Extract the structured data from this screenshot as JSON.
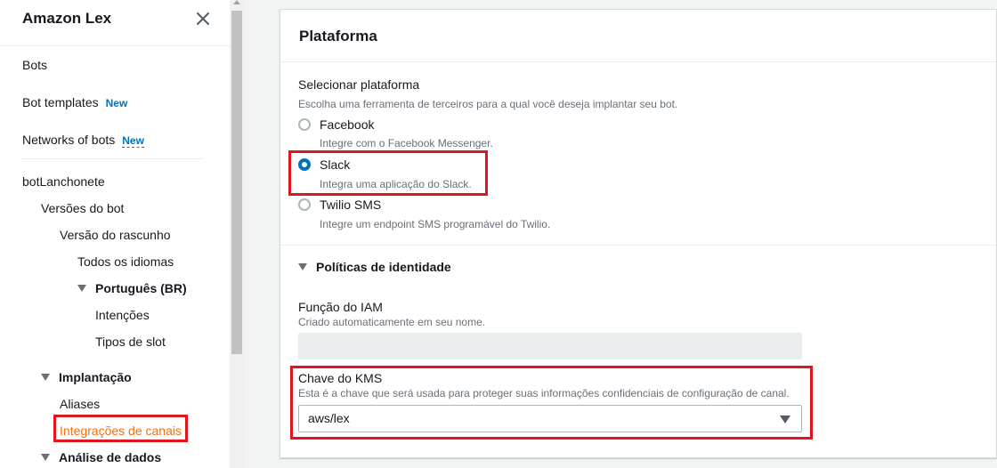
{
  "sidebar": {
    "title": "Amazon Lex",
    "items": {
      "bots": "Bots",
      "bot_templates": "Bot templates",
      "bot_templates_badge": "New",
      "networks_of_bots": "Networks of bots",
      "networks_badge": "New",
      "bot_name": "botLanchonete",
      "bot_versions": "Versões do bot",
      "draft_version": "Versão do rascunho",
      "all_languages": "Todos os idiomas",
      "language": "Português (BR)",
      "intents": "Intenções",
      "slot_types": "Tipos de slot",
      "deployment": "Implantação",
      "aliases": "Aliases",
      "channel_integrations": "Integrações de canais",
      "data_analysis": "Análise de dados"
    }
  },
  "panel": {
    "title": "Plataforma",
    "platform_label": "Selecionar plataforma",
    "platform_desc": "Escolha uma ferramenta de terceiros para a qual você deseja implantar seu bot.",
    "options": [
      {
        "label": "Facebook",
        "desc": "Integre com o Facebook Messenger.",
        "selected": false
      },
      {
        "label": "Slack",
        "desc": "Integra uma aplicação do Slack.",
        "selected": true
      },
      {
        "label": "Twilio SMS",
        "desc": "Integre um endpoint SMS programável do Twilio.",
        "selected": false
      }
    ],
    "identity_policies": "Políticas de identidade",
    "iam_label": "Função do IAM",
    "iam_desc": "Criado automaticamente em seu nome.",
    "iam_value": "",
    "kms_label": "Chave do KMS",
    "kms_desc": "Esta é a chave que será usada para proteger suas informações confidenciais de configuração de canal.",
    "kms_value": "aws/lex"
  },
  "colors": {
    "accent": "#0073bb",
    "active_link": "#ec7211",
    "highlight_box": "#e0161e"
  }
}
